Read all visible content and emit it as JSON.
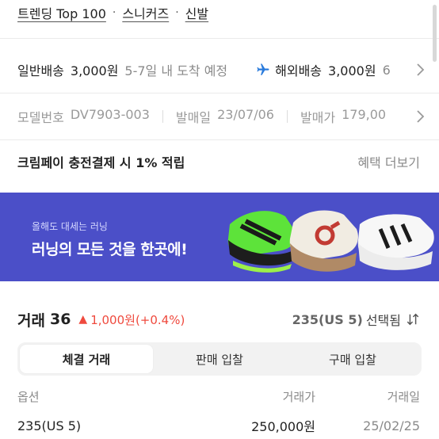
{
  "breadcrumb": [
    "트렌딩 Top 100",
    "스니커즈",
    "신발"
  ],
  "breadcrumb_separator": "·",
  "shipping": {
    "domestic_label": "일반배송",
    "domestic_price": "3,000원",
    "domestic_eta": "5-7일 내 도착 예정",
    "overseas_icon": "airplane-icon",
    "overseas_label": "해외배송",
    "overseas_price": "3,000원",
    "overseas_eta": "6"
  },
  "product_info": {
    "model_label": "모델번호",
    "model_value": "DV7903-003",
    "release_label": "발매일",
    "release_value": "23/07/06",
    "price_label": "발매가",
    "price_value": "179,00"
  },
  "kream_pay": {
    "text": "크림페이 충전결제 시 1% 적립",
    "more_label": "혜택 더보기"
  },
  "banner": {
    "subtitle": "올해도 대세는 러닝",
    "title": "러닝의 모든 것을 한곳에!",
    "background": "#4b4fc8"
  },
  "trades": {
    "label": "거래",
    "count": "36",
    "change_icon": "▲",
    "change_text": "1,000원(+0.4%)",
    "change_color": "#ef4a3e",
    "selected_size": "235(US 5)",
    "selected_label": "선택됨",
    "sort_icon": "sort-arrows-icon"
  },
  "tabs": [
    {
      "label": "체결 거래",
      "active": true
    },
    {
      "label": "판매 입찰",
      "active": false
    },
    {
      "label": "구매 입찰",
      "active": false
    }
  ],
  "table": {
    "headers": [
      "옵션",
      "거래가",
      "거래일"
    ],
    "rows": [
      {
        "option": "235(US 5)",
        "price": "250,000원",
        "date": "25/02/25"
      }
    ]
  }
}
